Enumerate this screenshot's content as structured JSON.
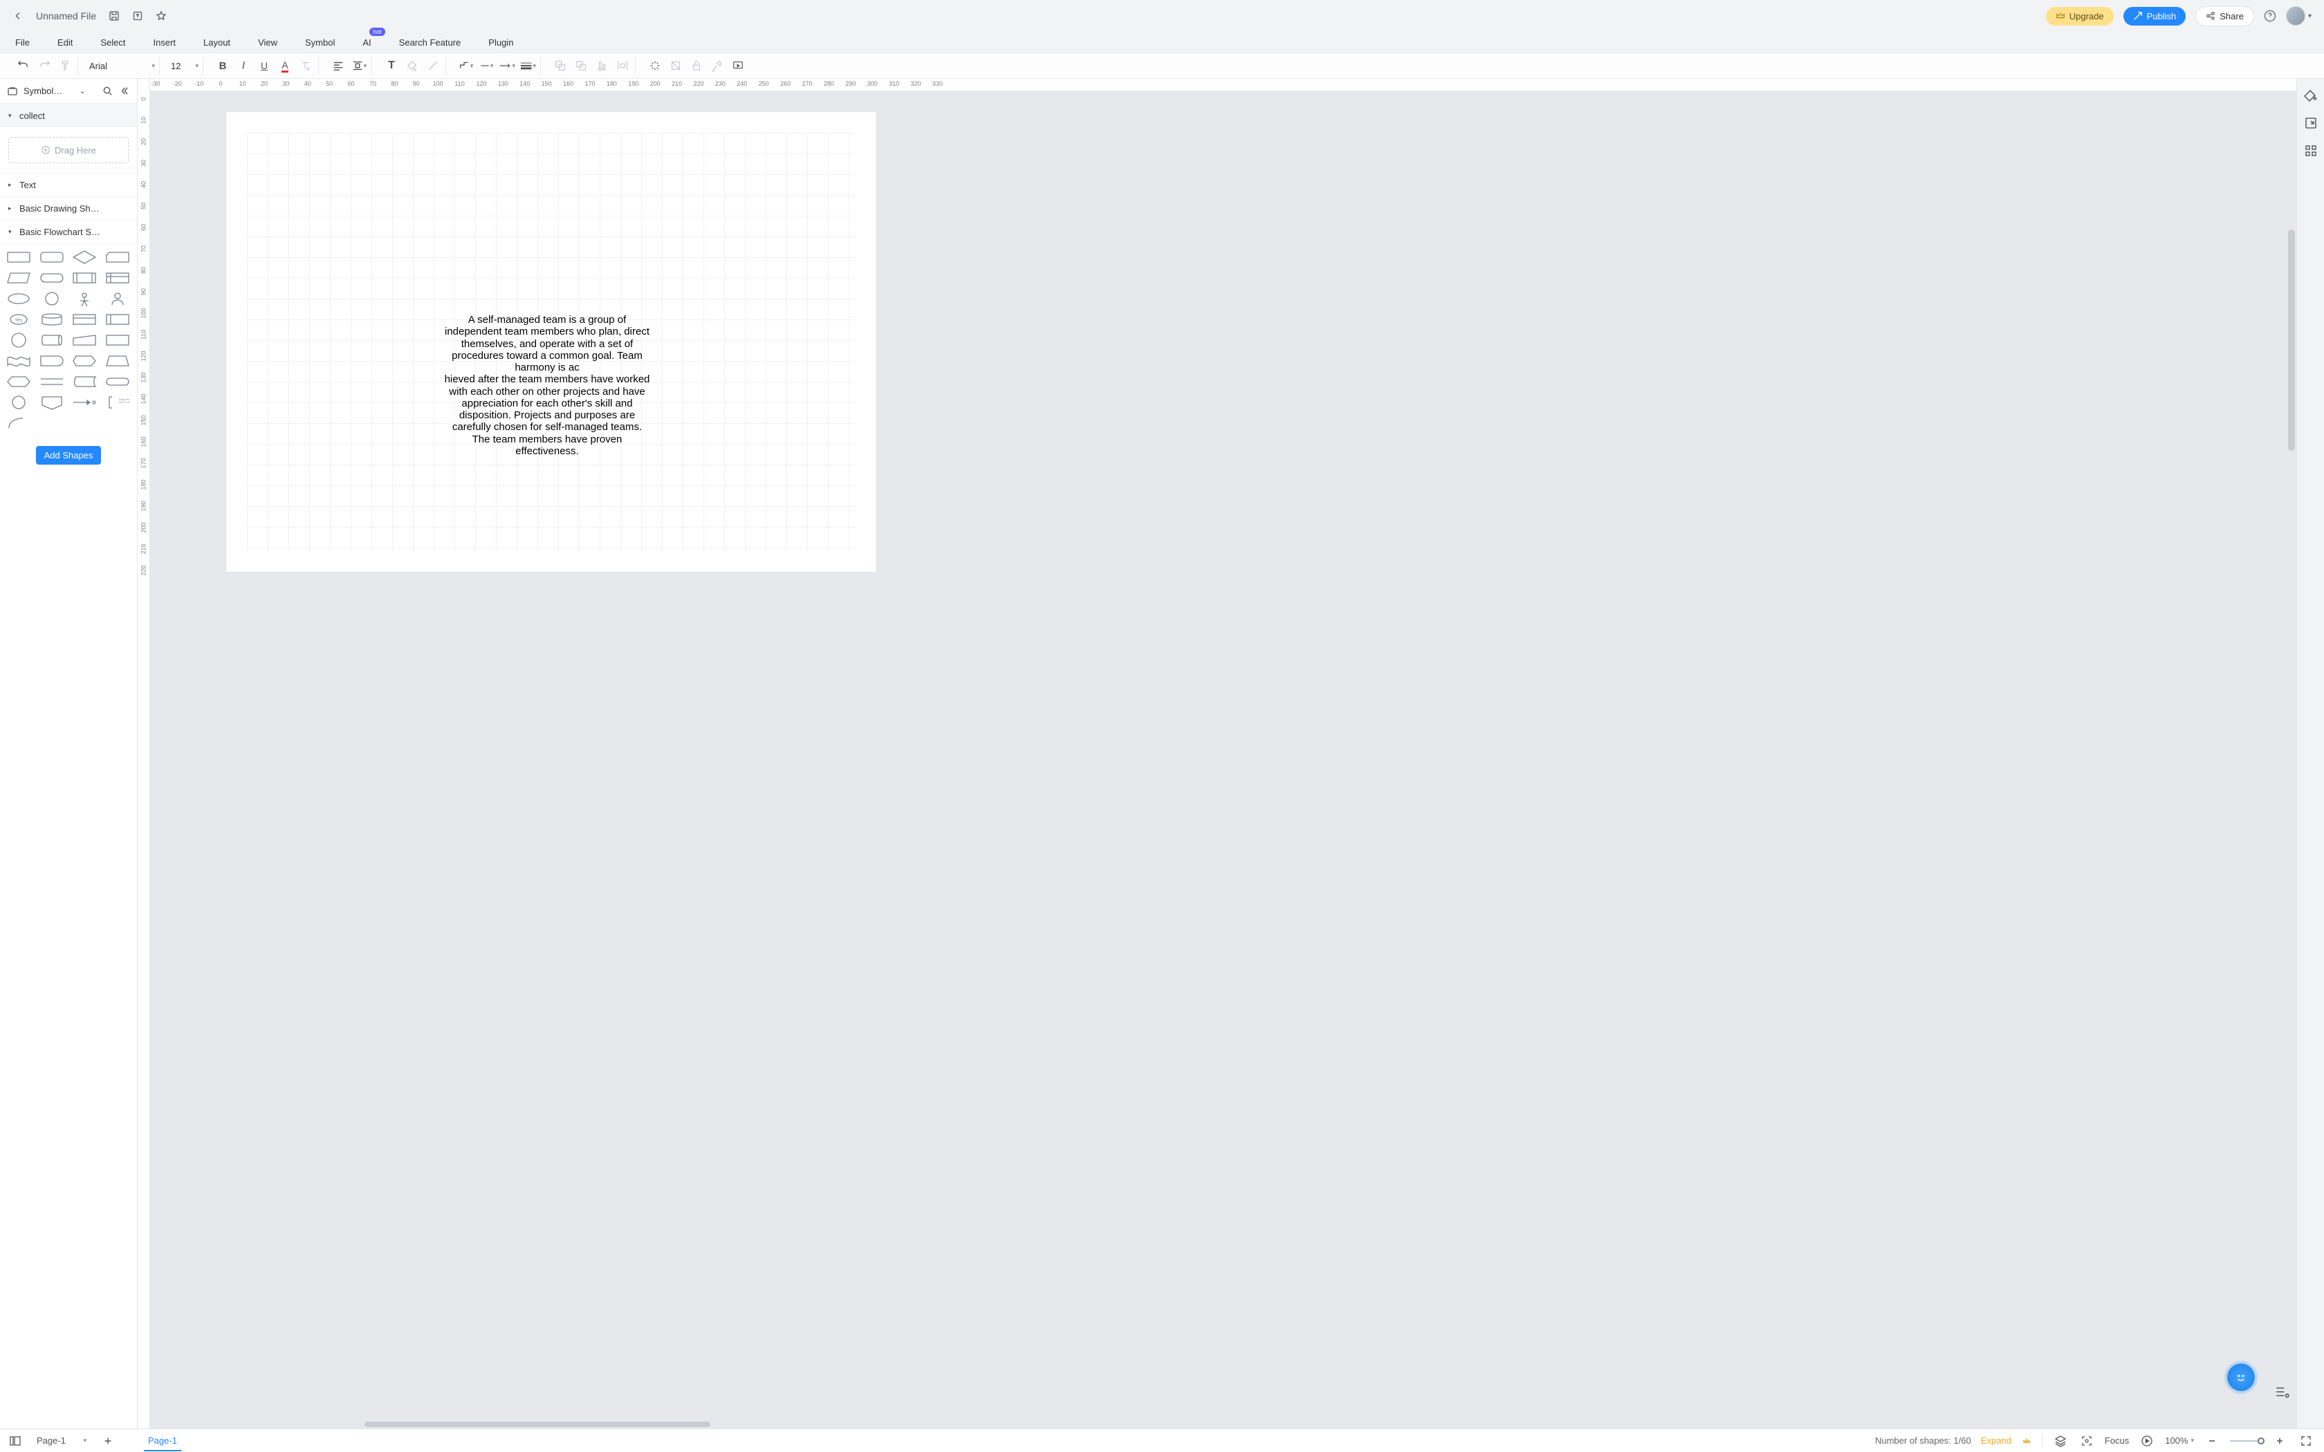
{
  "header": {
    "filename": "Unnamed File",
    "upgrade_label": "Upgrade",
    "publish_label": "Publish",
    "share_label": "Share"
  },
  "menu": {
    "file": "File",
    "edit": "Edit",
    "select": "Select",
    "insert": "Insert",
    "layout": "Layout",
    "view": "View",
    "symbol": "Symbol",
    "ai": "AI",
    "ai_hot": "hot",
    "search_feature": "Search Feature",
    "plugin": "Plugin"
  },
  "toolbar": {
    "font": "Arial",
    "size": "12"
  },
  "sidebar": {
    "library_title": "Symbol…",
    "sections": {
      "collect": "collect",
      "drag_here": "Drag Here",
      "text": "Text",
      "basic_drawing": "Basic Drawing Sh…",
      "basic_flowchart": "Basic Flowchart S…",
      "yes_label": "Yes"
    },
    "add_shapes": "Add Shapes"
  },
  "ruler_h": [
    -30,
    -20,
    -10,
    0,
    10,
    20,
    30,
    40,
    50,
    60,
    70,
    80,
    90,
    100,
    110,
    120,
    130,
    140,
    150,
    160,
    170,
    180,
    190,
    200,
    210,
    220,
    230,
    240,
    250,
    260,
    270,
    280,
    290,
    300,
    310,
    320,
    330
  ],
  "ruler_v": [
    0,
    10,
    20,
    30,
    40,
    50,
    60,
    70,
    80,
    90,
    100,
    110,
    120,
    130,
    140,
    150,
    160,
    170,
    180,
    190,
    200,
    210,
    220
  ],
  "canvas": {
    "text_block": "A self-managed team is a group of independent team members who plan, direct themselves, and operate with a set of procedures toward a common goal. Team harmony is ac\nhieved after the team members have worked with each other on other projects and have appreciation for each other's skill and disposition. Projects and purposes are carefully chosen for self-managed teams. The team members have proven effectiveness."
  },
  "bottom": {
    "page_label": "Page-1",
    "tab_label": "Page-1",
    "shape_count_prefix": "Number of shapes: ",
    "shape_count_value": "1/60",
    "expand": "Expand",
    "focus": "Focus",
    "zoom": "100%"
  }
}
